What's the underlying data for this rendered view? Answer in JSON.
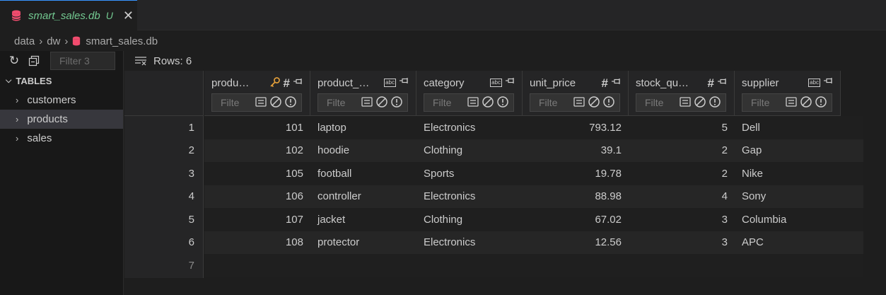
{
  "tab": {
    "title": "smart_sales.db",
    "status": "U",
    "close": "✕"
  },
  "breadcrumb": [
    "data",
    "dw",
    "smart_sales.db"
  ],
  "sidebar": {
    "filter_placeholder": "Filter 3",
    "section": "TABLES",
    "items": [
      {
        "label": "customers",
        "active": false
      },
      {
        "label": "products",
        "active": true
      },
      {
        "label": "sales",
        "active": false
      }
    ]
  },
  "main": {
    "rows_label": "Rows: 6"
  },
  "filter_placeholder": "Filte",
  "columns": [
    {
      "name": "produ…",
      "type": "number",
      "key": true
    },
    {
      "name": "product_…",
      "type": "text",
      "key": false
    },
    {
      "name": "category",
      "type": "text",
      "key": false
    },
    {
      "name": "unit_price",
      "type": "number",
      "key": false
    },
    {
      "name": "stock_qu…",
      "type": "number",
      "key": false
    },
    {
      "name": "supplier",
      "type": "text",
      "key": false
    }
  ],
  "rows": [
    {
      "n": "1",
      "cells": [
        "101",
        "laptop",
        "Electronics",
        "793.12",
        "5",
        "Dell"
      ]
    },
    {
      "n": "2",
      "cells": [
        "102",
        "hoodie",
        "Clothing",
        "39.1",
        "2",
        "Gap"
      ]
    },
    {
      "n": "3",
      "cells": [
        "105",
        "football",
        "Sports",
        "19.78",
        "2",
        "Nike"
      ]
    },
    {
      "n": "4",
      "cells": [
        "106",
        "controller",
        "Electronics",
        "88.98",
        "4",
        "Sony"
      ]
    },
    {
      "n": "5",
      "cells": [
        "107",
        "jacket",
        "Clothing",
        "67.02",
        "3",
        "Columbia"
      ]
    },
    {
      "n": "6",
      "cells": [
        "108",
        "protector",
        "Electronics",
        "12.56",
        "3",
        "APC"
      ]
    }
  ],
  "new_row_number": "7",
  "colors": {
    "accent": "#3794ff",
    "modified": "#73c991",
    "db_icon": "#f14c6e",
    "key_icon": "#e8a23a"
  }
}
